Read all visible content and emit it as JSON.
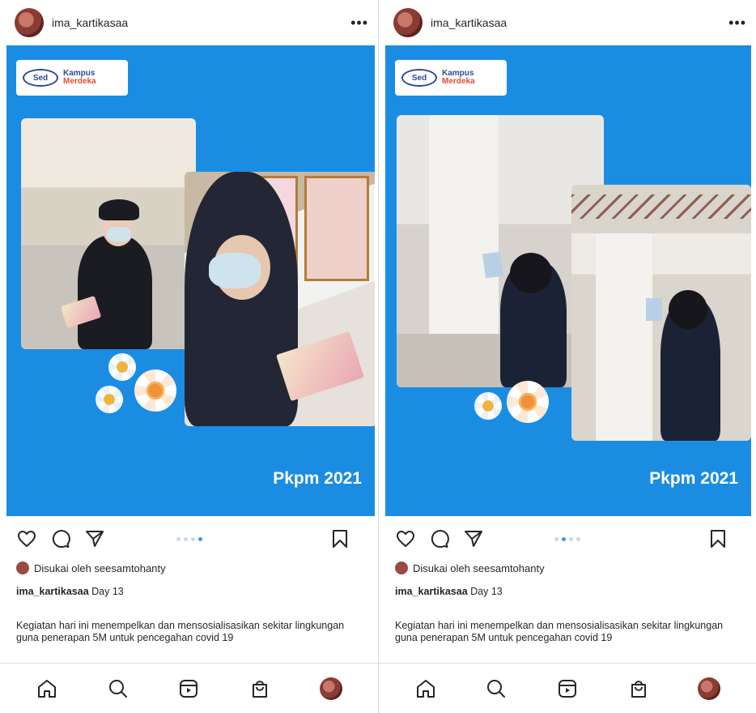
{
  "colors": {
    "post_background": "#1a8de3",
    "accent_blue": "#3897f0",
    "text": "#262626",
    "divider": "#dbdbdb"
  },
  "posts": [
    {
      "username": "ima_kartikasaa",
      "more_icon": "more-horizontal-icon",
      "logo_badge": "Sed",
      "logo_line1": "Kampus",
      "logo_line2": "Merdeka",
      "tag": "Pkpm 2021",
      "carousel_total": 4,
      "carousel_active": 3,
      "likes_text": "Disukai oleh seesamtohanty",
      "caption_user": "ima_kartikasaa",
      "caption_title": "Day 13",
      "caption_body": "Kegiatan hari ini menempelkan dan mensosialisasikan sekitar lingkungan guna penerapan 5M untuk pencegahan covid 19",
      "icons": [
        "heart-icon",
        "comment-icon",
        "share-icon",
        "bookmark-icon"
      ],
      "nav": [
        "home-icon",
        "search-icon",
        "reels-icon",
        "shop-icon",
        "profile-avatar"
      ]
    },
    {
      "username": "ima_kartikasaa",
      "more_icon": "more-horizontal-icon",
      "logo_badge": "Sed",
      "logo_line1": "Kampus",
      "logo_line2": "Merdeka",
      "tag": "Pkpm 2021",
      "carousel_total": 4,
      "carousel_active": 2,
      "likes_text": "Disukai oleh seesamtohanty",
      "caption_user": "ima_kartikasaa",
      "caption_title": "Day 13",
      "caption_body": "Kegiatan hari ini menempelkan dan mensosialisasikan sekitar lingkungan guna penerapan 5M untuk pencegahan covid 19",
      "icons": [
        "heart-icon",
        "comment-icon",
        "share-icon",
        "bookmark-icon"
      ],
      "nav": [
        "home-icon",
        "search-icon",
        "reels-icon",
        "shop-icon",
        "profile-avatar"
      ]
    }
  ]
}
